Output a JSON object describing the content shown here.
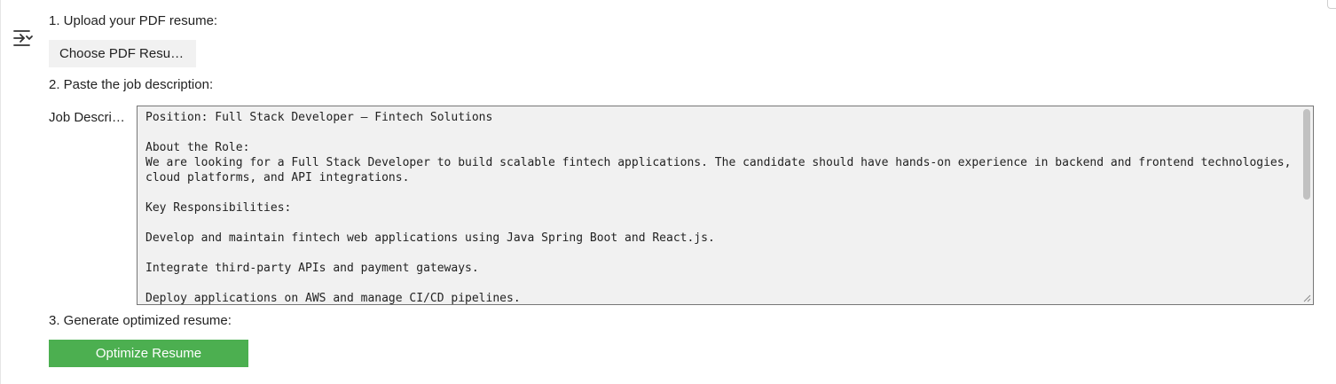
{
  "sidebar": {
    "toggle_icon": "collapse-panel-icon"
  },
  "steps": {
    "upload_label": "1. Upload your PDF resume:",
    "paste_label": "2. Paste the job description:",
    "generate_label": "3. Generate optimized resume:"
  },
  "upload": {
    "button_label": "Choose PDF Resume"
  },
  "job_description": {
    "label": "Job Description",
    "value": "Position: Full Stack Developer – Fintech Solutions\n\nAbout the Role:\nWe are looking for a Full Stack Developer to build scalable fintech applications. The candidate should have hands-on experience in backend and frontend technologies, cloud platforms, and API integrations.\n\nKey Responsibilities:\n\nDevelop and maintain fintech web applications using Java Spring Boot and React.js.\n\nIntegrate third-party APIs and payment gateways.\n\nDeploy applications on AWS and manage CI/CD pipelines."
  },
  "actions": {
    "optimize_label": "Optimize Resume"
  },
  "colors": {
    "primary_button": "#4caf50",
    "secondary_button": "#f1f1f1",
    "textarea_background": "#f1f1f1"
  }
}
